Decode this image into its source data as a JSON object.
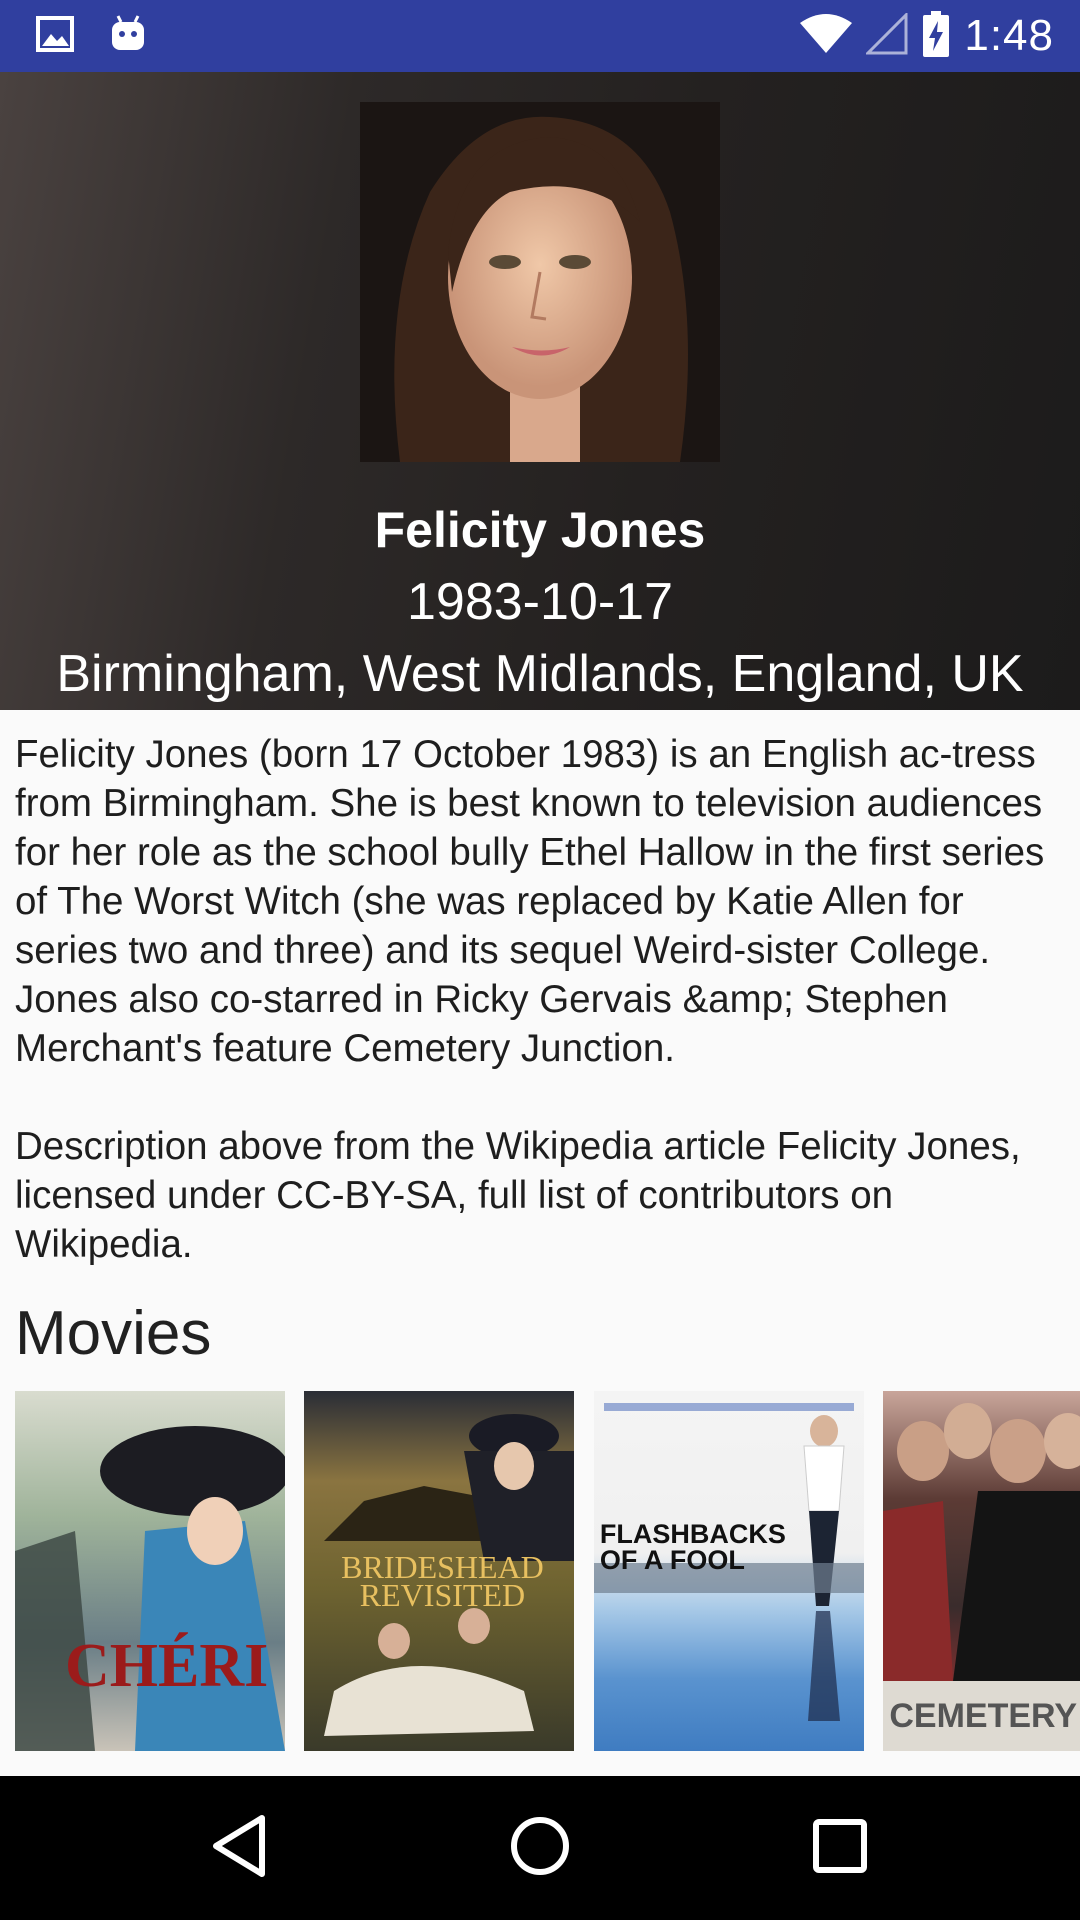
{
  "status_bar": {
    "time": "1:48",
    "left_icons": [
      "image-icon",
      "android-icon"
    ],
    "right_icons": [
      "wifi-icon",
      "signal-icon",
      "battery-charging-icon"
    ],
    "background": "#303f9f"
  },
  "person": {
    "name": "Felicity Jones",
    "birthday": "1983-10-17",
    "birthplace": "Birmingham, West Midlands, England, UK"
  },
  "bio": {
    "paragraph1": "Felicity Jones (born 17 October 1983) is an English ac-tress from Birmingham. She is best known to television audiences for her role as the school bully Ethel Hallow in the first series of The Worst Witch (she was replaced by Katie Allen for series two and three) and its sequel Weird-sister College. Jones also co-starred in Ricky Gervais &amp; Stephen Merchant's feature Cemetery Junction.",
    "paragraph2": "Description above from the Wikipedia article Felicity Jones, licensed under CC-BY-SA, full list of contributors on Wikipedia."
  },
  "movies": {
    "heading": "Movies",
    "items": [
      {
        "title": "CHÉRI"
      },
      {
        "title": "BRIDESHEAD REVISITED"
      },
      {
        "title": "FLASHBACKS OF A FOOL"
      },
      {
        "title": "CEMETERY JUNCT"
      }
    ]
  },
  "nav_bar": {
    "buttons": [
      "back-icon",
      "home-icon",
      "recents-icon"
    ]
  }
}
